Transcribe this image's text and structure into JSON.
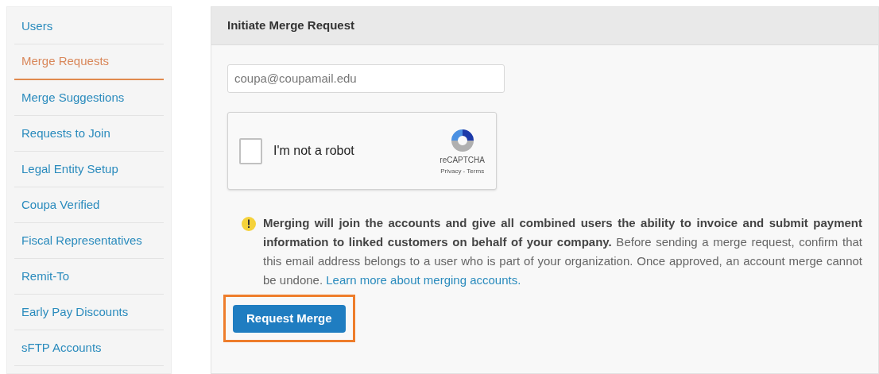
{
  "sidebar": {
    "items": [
      {
        "label": "Users",
        "selected": false
      },
      {
        "label": "Merge Requests",
        "selected": true
      },
      {
        "label": "Merge Suggestions",
        "selected": false
      },
      {
        "label": "Requests to Join",
        "selected": false
      },
      {
        "label": "Legal Entity Setup",
        "selected": false
      },
      {
        "label": "Coupa Verified",
        "selected": false
      },
      {
        "label": "Fiscal Representatives",
        "selected": false
      },
      {
        "label": "Remit-To",
        "selected": false
      },
      {
        "label": "Early Pay Discounts",
        "selected": false
      },
      {
        "label": "sFTP Accounts",
        "selected": false
      }
    ]
  },
  "panel": {
    "title": "Initiate Merge Request",
    "email_field": {
      "value": "coupa@coupamail.edu"
    },
    "captcha": {
      "label": "I'm not a robot",
      "checked": false,
      "brand": "reCAPTCHA",
      "links": "Privacy - Terms"
    },
    "warning": {
      "text": "**Merging will join the accounts and give all combined users the ability to invoice and submit payment information to linked customers on behalf of your company.** Before sending a merge request, confirm that this email address belongs to a user who is part of your organization. Once approved, an account merge cannot be undone.",
      "link": "Learn more about merging accounts."
    },
    "button": {
      "label": "Request Merge",
      "highlighted": true
    }
  }
}
